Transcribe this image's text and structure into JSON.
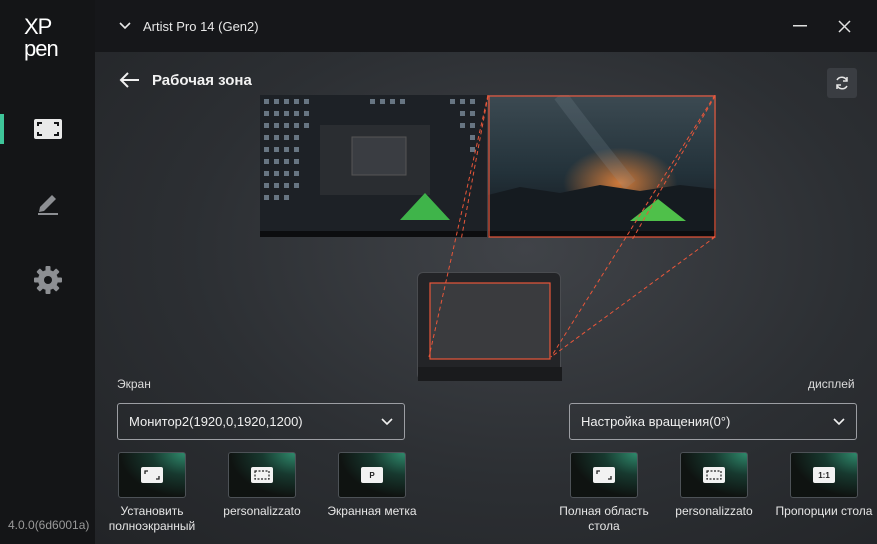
{
  "app": {
    "logo_text": "XPpen",
    "version": "4.0.0(6d6001a)"
  },
  "sidebar": {
    "items": [
      {
        "name": "work-area",
        "icon": "fullscreen-frame-icon",
        "active": true
      },
      {
        "name": "pen",
        "icon": "pen-icon",
        "active": false
      },
      {
        "name": "settings",
        "icon": "gear-icon",
        "active": false
      }
    ]
  },
  "topbar": {
    "device_name": "Artist Pro 14 (Gen2)",
    "icons": [
      "chevron-down-icon",
      "minimize-icon",
      "close-icon"
    ]
  },
  "page": {
    "title": "Рабочая зона",
    "accent": "#e8563a"
  },
  "left": {
    "label": "Экран",
    "select_value": "Монитор2(1920,0,1920,1200)",
    "options": [
      {
        "label": "Установить\nполноэкранный",
        "icon": "fullscreen-icon"
      },
      {
        "label": "personalizzato",
        "icon": "custom-area-icon"
      },
      {
        "label": "Экранная метка",
        "icon": "screen-mark-icon",
        "glyph": "P"
      }
    ]
  },
  "right": {
    "label": "дисплей",
    "select_value": "Настройка вращения(0°)",
    "options": [
      {
        "label": "Полная область\nстола",
        "icon": "full-area-icon"
      },
      {
        "label": "personalizzato",
        "icon": "custom-area-icon"
      },
      {
        "label": "Пропорции стола",
        "icon": "ratio-icon",
        "glyph": "1:1"
      }
    ]
  }
}
